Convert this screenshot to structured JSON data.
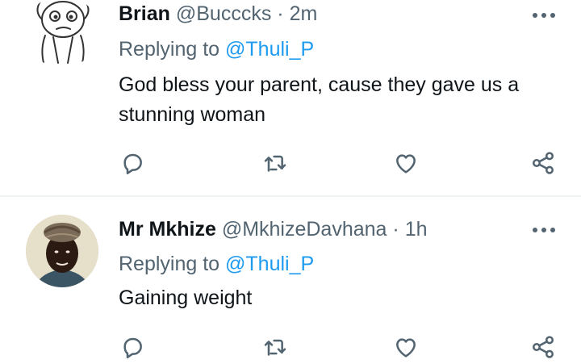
{
  "tweets": [
    {
      "name": "Brian",
      "handle": "@Bucccks",
      "separator": "·",
      "time": "2m",
      "replying_prefix": "Replying to",
      "replying_to": "@Thuli_P",
      "text": "God bless your parent, cause they gave us a stunning woman",
      "avatar_icon": "doodle-face-avatar"
    },
    {
      "name": "Mr Mkhize",
      "handle": "@MkhizeDavhana",
      "separator": "·",
      "time": "1h",
      "replying_prefix": "Replying to",
      "replying_to": "@Thuli_P",
      "text": "Gaining weight",
      "avatar_icon": "photo-avatar"
    }
  ],
  "actions": [
    "reply-icon",
    "retweet-icon",
    "like-icon",
    "share-icon"
  ],
  "colors": {
    "text": "#0f1419",
    "secondary": "#536471",
    "link": "#1d9bf0",
    "divider": "#eff3f4"
  }
}
